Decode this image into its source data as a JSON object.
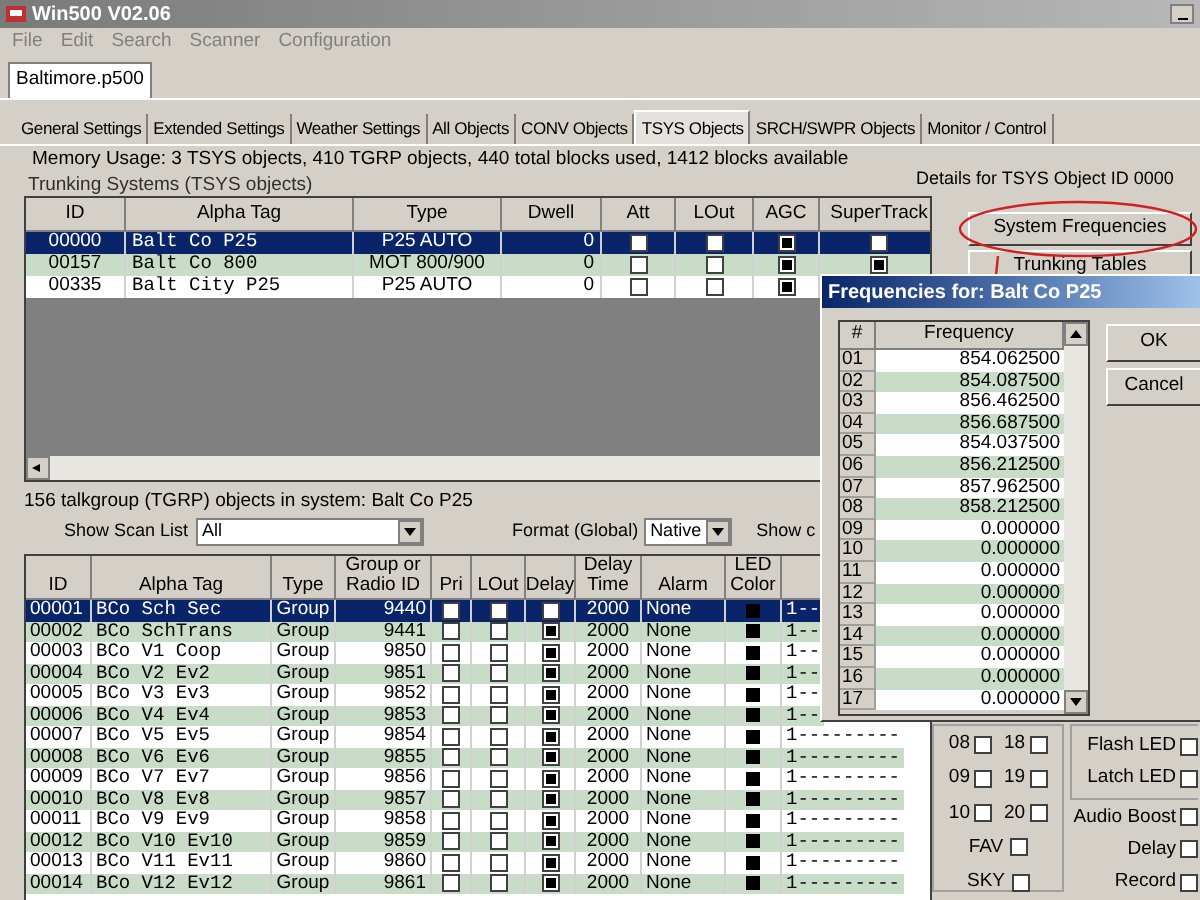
{
  "window": {
    "title": "Win500 V02.06"
  },
  "menu": [
    "File",
    "Edit",
    "Search",
    "Scanner",
    "Configuration"
  ],
  "file_tabs": [
    {
      "label": "Baltimore.p500",
      "selected": true
    }
  ],
  "tabs": [
    {
      "label": "General Settings",
      "selected": false
    },
    {
      "label": "Extended Settings",
      "selected": false
    },
    {
      "label": "Weather Settings",
      "selected": false
    },
    {
      "label": "All Objects",
      "selected": false
    },
    {
      "label": "CONV Objects",
      "selected": false
    },
    {
      "label": "TSYS Objects",
      "selected": true
    },
    {
      "label": "SRCH/SWPR Objects",
      "selected": false
    },
    {
      "label": "Monitor / Control",
      "selected": false
    }
  ],
  "memory_usage": "Memory Usage: 3 TSYS objects, 410 TGRP objects, 440 total blocks used, 1412 blocks available",
  "details_label": "Details for TSYS Object ID 0000",
  "tsys": {
    "label": "Trunking Systems (TSYS objects)",
    "columns": [
      "ID",
      "Alpha Tag",
      "Type",
      "Dwell",
      "Att",
      "LOut",
      "AGC",
      "SuperTrack"
    ],
    "rows": [
      {
        "id": "00000",
        "alpha_tag": "Balt Co P25",
        "type": "P25 AUTO",
        "dwell": "0",
        "att": false,
        "lout": false,
        "agc": true,
        "supertrack": false,
        "selected": true
      },
      {
        "id": "00157",
        "alpha_tag": "Balt Co 800",
        "type": "MOT 800/900",
        "dwell": "0",
        "att": false,
        "lout": false,
        "agc": true,
        "supertrack": true,
        "selected": false
      },
      {
        "id": "00335",
        "alpha_tag": "Balt City P25",
        "type": "P25 AUTO",
        "dwell": "0",
        "att": false,
        "lout": false,
        "agc": true,
        "selected": false
      }
    ]
  },
  "buttons": [
    "System Frequencies",
    "Trunking Tables"
  ],
  "tgrp": {
    "label": "156 talkgroup (TGRP) objects in system: Balt Co P25",
    "scan_list": {
      "label": "Show Scan List",
      "value": "All"
    },
    "format": {
      "label": "Format (Global)",
      "value": "Native"
    },
    "show_cut": "Show c",
    "columns": [
      "ID",
      "Alpha Tag",
      "Type",
      "Group or Radio ID",
      "Pri",
      "LOut",
      "Delay",
      "Delay Time",
      "Alarm",
      "LED Color"
    ],
    "rows": [
      {
        "id": "00001",
        "alpha_tag": "BCo Sch Sec",
        "type": "Group",
        "group_id": "9440",
        "pri": false,
        "lout": false,
        "delay": false,
        "delay_time": "2000",
        "alarm": "None",
        "color": "#000000",
        "column_11": "1--",
        "selected": true
      },
      {
        "id": "00002",
        "alpha_tag": "BCo SchTrans",
        "type": "Group",
        "group_id": "9441",
        "pri": false,
        "lout": false,
        "delay": true,
        "delay_time": "2000",
        "alarm": "None",
        "color": "#000000",
        "column_11": "1--",
        "selected": false
      },
      {
        "id": "00003",
        "alpha_tag": "BCo V1 Coop",
        "type": "Group",
        "group_id": "9850",
        "pri": false,
        "lout": false,
        "delay": true,
        "delay_time": "2000",
        "alarm": "None",
        "color": "#000000",
        "column_11": "1--",
        "selected": false
      },
      {
        "id": "00004",
        "alpha_tag": "BCo V2 Ev2",
        "type": "Group",
        "group_id": "9851",
        "pri": false,
        "lout": false,
        "delay": true,
        "delay_time": "2000",
        "alarm": "None",
        "color": "#000000",
        "column_11": "1--",
        "selected": false
      },
      {
        "id": "00005",
        "alpha_tag": "BCo V3 Ev3",
        "type": "Group",
        "group_id": "9852",
        "pri": false,
        "lout": false,
        "delay": true,
        "delay_time": "2000",
        "alarm": "None",
        "color": "#000000",
        "column_11": "1--",
        "selected": false
      },
      {
        "id": "00006",
        "alpha_tag": "BCo V4 Ev4",
        "type": "Group",
        "group_id": "9853",
        "pri": false,
        "lout": false,
        "delay": true,
        "delay_time": "2000",
        "alarm": "None",
        "color": "#000000",
        "column_11": "1--",
        "selected": false
      },
      {
        "id": "00007",
        "alpha_tag": "BCo V5 Ev5",
        "type": "Group",
        "group_id": "9854",
        "pri": false,
        "lout": false,
        "delay": true,
        "delay_time": "2000",
        "alarm": "None",
        "color": "#000000",
        "column_11": "1---------",
        "selected": false
      },
      {
        "id": "00008",
        "alpha_tag": "BCo V6 Ev6",
        "type": "Group",
        "group_id": "9855",
        "pri": false,
        "lout": false,
        "delay": true,
        "delay_time": "2000",
        "alarm": "None",
        "color": "#000000",
        "column_11": "1---------",
        "selected": false
      },
      {
        "id": "00009",
        "alpha_tag": "BCo V7 Ev7",
        "type": "Group",
        "group_id": "9856",
        "pri": false,
        "lout": false,
        "delay": true,
        "delay_time": "2000",
        "alarm": "None",
        "color": "#000000",
        "column_11": "1---------",
        "selected": false
      },
      {
        "id": "00010",
        "alpha_tag": "BCo V8 Ev8",
        "type": "Group",
        "group_id": "9857",
        "pri": false,
        "lout": false,
        "delay": true,
        "delay_time": "2000",
        "alarm": "None",
        "color": "#000000",
        "column_11": "1---------",
        "selected": false
      },
      {
        "id": "00011",
        "alpha_tag": "BCo V9 Ev9",
        "type": "Group",
        "group_id": "9858",
        "pri": false,
        "lout": false,
        "delay": true,
        "delay_time": "2000",
        "alarm": "None",
        "color": "#000000",
        "column_11": "1---------",
        "selected": false
      },
      {
        "id": "00012",
        "alpha_tag": "BCo V10 Ev10",
        "type": "Group",
        "group_id": "9859",
        "pri": false,
        "lout": false,
        "delay": true,
        "delay_time": "2000",
        "alarm": "None",
        "color": "#000000",
        "column_11": "1---------",
        "selected": false
      },
      {
        "id": "00013",
        "alpha_tag": "BCo V11 Ev11",
        "type": "Group",
        "group_id": "9860",
        "pri": false,
        "lout": false,
        "delay": true,
        "delay_time": "2000",
        "alarm": "None",
        "color": "#000000",
        "column_11": "1---------",
        "selected": false
      },
      {
        "id": "00014",
        "alpha_tag": "BCo V12 Ev12",
        "type": "Group",
        "group_id": "9861",
        "pri": false,
        "lout": false,
        "delay": true,
        "delay_time": "2000",
        "alarm": "None",
        "color": "#000000",
        "column_11": "1---------",
        "selected": false
      }
    ]
  },
  "scan_checks": [
    {
      "label": "08",
      "checked": false
    },
    {
      "label": "18",
      "checked": false
    },
    {
      "label": "09",
      "checked": false
    },
    {
      "label": "19",
      "checked": false
    },
    {
      "label": "10",
      "checked": false
    },
    {
      "label": "20",
      "checked": false
    }
  ],
  "flags": [
    {
      "label": "FAV",
      "checked": false
    },
    {
      "label": "SKY",
      "checked": false
    }
  ],
  "led_options": [
    {
      "label": "Flash LED",
      "checked": false
    },
    {
      "label": "Latch LED",
      "checked": false
    }
  ],
  "options": [
    {
      "label": "Audio Boost",
      "checked": false
    },
    {
      "label": "Delay",
      "checked": false
    },
    {
      "label": "Record",
      "checked": false
    }
  ],
  "dialog": {
    "title": "Frequencies for: Balt Co P25",
    "columns": [
      "#",
      "Frequency"
    ],
    "rows": [
      {
        "num": "01",
        "frequency": "854.062500"
      },
      {
        "num": "02",
        "frequency": "854.087500"
      },
      {
        "num": "03",
        "frequency": "856.462500"
      },
      {
        "num": "04",
        "frequency": "856.687500"
      },
      {
        "num": "05",
        "frequency": "854.037500"
      },
      {
        "num": "06",
        "frequency": "856.212500"
      },
      {
        "num": "07",
        "frequency": "857.962500"
      },
      {
        "num": "08",
        "frequency": "858.212500"
      },
      {
        "num": "09",
        "frequency": "0.000000"
      },
      {
        "num": "10",
        "frequency": "0.000000"
      },
      {
        "num": "11",
        "frequency": "0.000000"
      },
      {
        "num": "12",
        "frequency": "0.000000"
      },
      {
        "num": "13",
        "frequency": "0.000000"
      },
      {
        "num": "14",
        "frequency": "0.000000"
      },
      {
        "num": "15",
        "frequency": "0.000000"
      },
      {
        "num": "16",
        "frequency": "0.000000"
      },
      {
        "num": "17",
        "frequency": "0.000000"
      }
    ],
    "buttons": [
      "OK",
      "Cancel"
    ]
  }
}
